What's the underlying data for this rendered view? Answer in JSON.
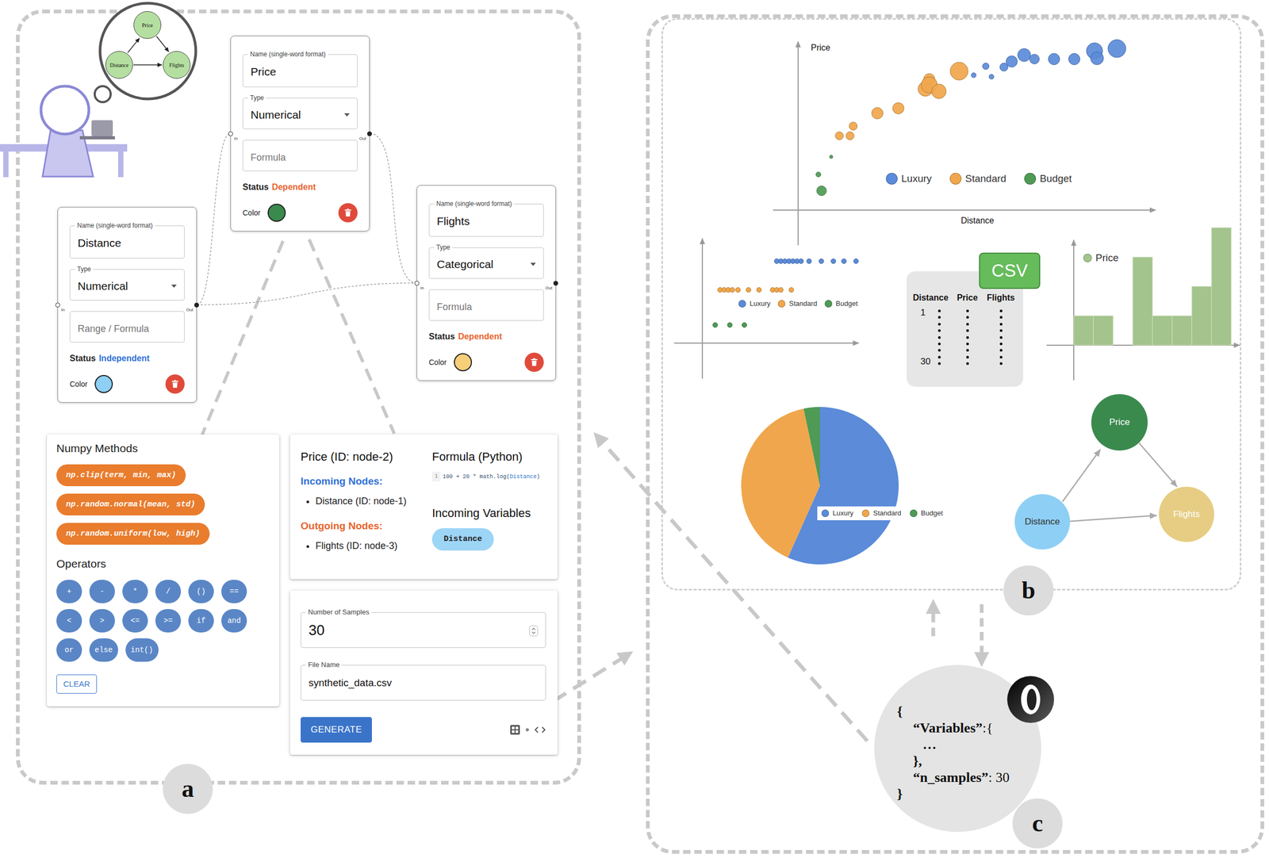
{
  "panel_a": {
    "label": "a",
    "thought": {
      "nodes": [
        "Price",
        "Distance",
        "Flights"
      ]
    },
    "nodes": [
      {
        "name_label": "Name (single-word format)",
        "name": "Distance",
        "type_label": "Type",
        "type": "Numerical",
        "formula_placeholder": "Range / Formula",
        "status_label": "Status",
        "status": "Independent",
        "status_color": "#2f6fd6",
        "color_label": "Color",
        "color": "#8ecff5",
        "port_in": "In",
        "port_out": "Out"
      },
      {
        "name_label": "Name (single-word format)",
        "name": "Price",
        "type_label": "Type",
        "type": "Numerical",
        "formula_placeholder": "Formula",
        "status_label": "Status",
        "status": "Dependent",
        "status_color": "#e8622c",
        "color_label": "Color",
        "color": "#3a8a4e",
        "port_in": "In",
        "port_out": "Out"
      },
      {
        "name_label": "Name (single-word format)",
        "name": "Flights",
        "type_label": "Type",
        "type": "Categorical",
        "formula_placeholder": "Formula",
        "status_label": "Status",
        "status": "Dependent",
        "status_color": "#e8622c",
        "color_label": "Color",
        "color": "#f7cf7a",
        "port_in": "In",
        "port_out": "Out"
      }
    ],
    "methods": {
      "title": "Numpy Methods",
      "items": [
        "np.clip(term, min, max)",
        "np.random.normal(mean, std)",
        "np.random.uniform(low, high)"
      ],
      "operators_title": "Operators",
      "operators": [
        "+",
        "-",
        "*",
        "/",
        "()",
        "==",
        "<",
        ">",
        "<=",
        ">=",
        "if",
        "and",
        "or",
        "else",
        "int()"
      ],
      "clear": "CLEAR"
    },
    "details": {
      "title": "Price (ID: node-2)",
      "incoming_title": "Incoming Nodes:",
      "incoming": [
        "Distance (ID: node-1)"
      ],
      "outgoing_title": "Outgoing Nodes:",
      "outgoing": [
        "Flights (ID: node-3)"
      ],
      "formula_title": "Formula (Python)",
      "line_number": "1",
      "code": [
        {
          "text": "100 + 20 * math.log(",
          "var": false
        },
        {
          "text": "Distance",
          "var": true
        },
        {
          "text": ")",
          "var": false
        }
      ],
      "variables_title": "Incoming Variables",
      "variables": [
        "Distance"
      ]
    },
    "generate": {
      "samples_label": "Number of Samples",
      "samples": "30",
      "file_label": "File Name",
      "file": "synthetic_data.csv",
      "button": "GENERATE"
    }
  },
  "panel_b": {
    "label": "b",
    "scatter": {
      "y_label": "Price",
      "x_label": "Distance",
      "series": [
        {
          "name": "Luxury",
          "color": "#5b8bd9",
          "points": [
            [
              49.4,
              79.5,
              3
            ],
            [
              52.8,
              84.8,
              4
            ],
            [
              54.4,
              78.6,
              3
            ],
            [
              57.9,
              84.3,
              5
            ],
            [
              60.1,
              87.6,
              7
            ],
            [
              63.6,
              91.4,
              8
            ],
            [
              66.5,
              89,
              6
            ],
            [
              72,
              89,
              7
            ],
            [
              77.7,
              89,
              7
            ],
            [
              83.4,
              93.8,
              10
            ],
            [
              84.1,
              89.5,
              8
            ],
            [
              89.7,
              95.2,
              11
            ]
          ]
        },
        {
          "name": "Standard",
          "color": "#f0a64c",
          "points": [
            [
              11.6,
              43.8,
              5
            ],
            [
              14.6,
              43.8,
              5
            ],
            [
              15.5,
              49.5,
              5
            ],
            [
              22.3,
              57.1,
              7
            ],
            [
              28.2,
              60,
              7
            ],
            [
              35.8,
              71.4,
              9
            ],
            [
              36.9,
              77.1,
              7
            ],
            [
              36.9,
              73.8,
              10
            ],
            [
              39.6,
              70,
              9
            ],
            [
              45.3,
              81.9,
              11
            ]
          ]
        },
        {
          "name": "Budget",
          "color": "#4f9a55",
          "points": [
            [
              6.6,
              11.4,
              6
            ],
            [
              5.7,
              21,
              3
            ],
            [
              9.3,
              31.4,
              2
            ]
          ]
        }
      ]
    },
    "strip": {
      "series": [
        {
          "name": "Luxury",
          "color": "#5b8bd9",
          "values": [
            47.4,
            50,
            52.6,
            55.2,
            57.7,
            60.3,
            62.9,
            68,
            75.8,
            83.5,
            90.2,
            97.9
          ]
        },
        {
          "name": "Standard",
          "color": "#f0a64c",
          "values": [
            11.3,
            13.9,
            16.5,
            19.1,
            22.7,
            29.4,
            36.1,
            44.8,
            47.4,
            50,
            56.7
          ]
        },
        {
          "name": "Budget",
          "color": "#4f9a55",
          "values": [
            8.2,
            17.5,
            26.8
          ]
        }
      ]
    },
    "csv": {
      "badge": "CSV",
      "columns": [
        "Distance",
        "Price",
        "Flights"
      ],
      "first_row": "1",
      "last_row": "30"
    },
    "histogram": {
      "legend": "Price",
      "color": "#a3c48c",
      "counts": [
        1,
        1,
        0,
        3,
        1,
        1,
        2,
        4
      ]
    },
    "pie": {
      "slices": [
        {
          "name": "Luxury",
          "value": 17,
          "color": "#5b8bd9"
        },
        {
          "name": "Standard",
          "value": 12,
          "color": "#f0a64c"
        },
        {
          "name": "Budget",
          "value": 1,
          "color": "#4f9a55"
        }
      ]
    },
    "graph": {
      "nodes": [
        {
          "name": "Price",
          "color": "#3a8a4e"
        },
        {
          "name": "Distance",
          "color": "#8ecff5"
        },
        {
          "name": "Flights",
          "color": "#e6cd83"
        }
      ]
    }
  },
  "panel_c": {
    "label": "c",
    "json_lines": [
      {
        "depth": 0,
        "text": "{"
      },
      {
        "depth": 1,
        "key": "“Variables”",
        "text": ":{"
      },
      {
        "depth": 2,
        "text": "…"
      },
      {
        "depth": 1,
        "text": "},"
      },
      {
        "depth": 1,
        "key": "“n_samples”",
        "text": ": 30"
      },
      {
        "depth": 0,
        "text": "}"
      }
    ]
  }
}
